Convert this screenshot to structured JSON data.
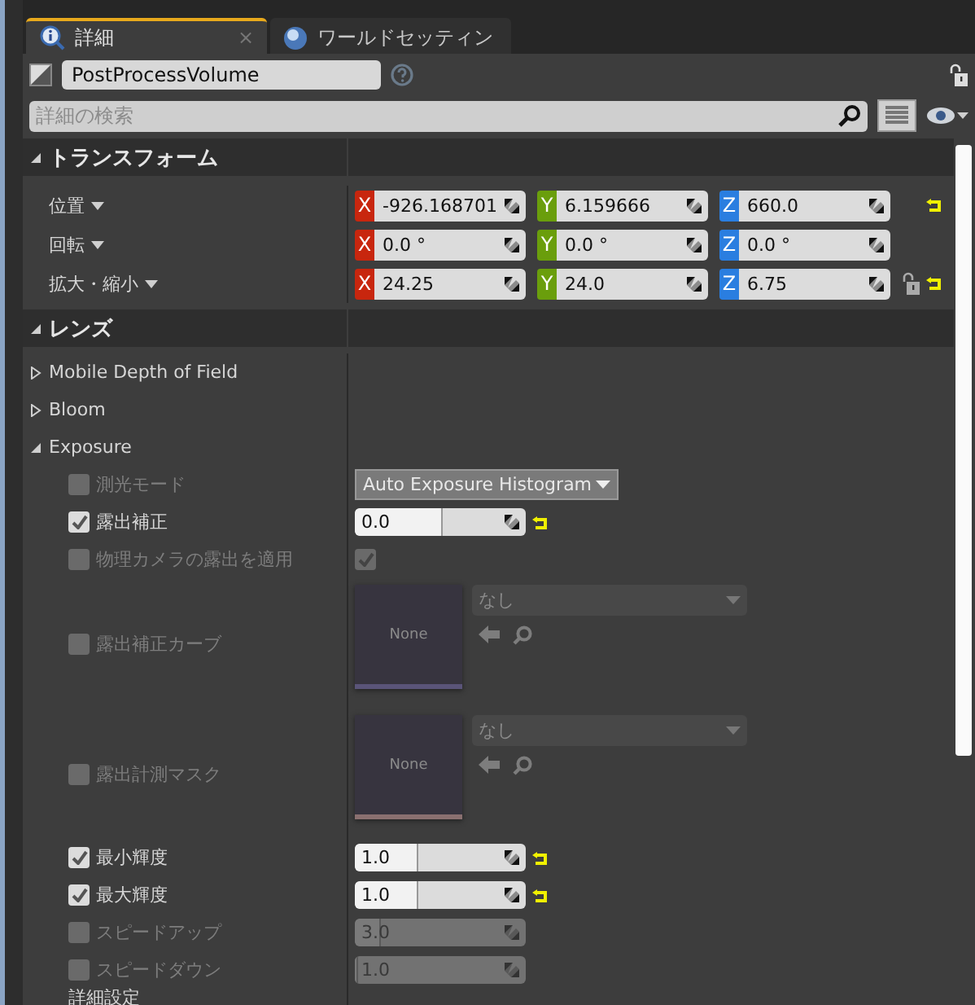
{
  "tabs": [
    {
      "label": "詳細",
      "selected": true,
      "close": "×"
    },
    {
      "label": "ワールドセッティン",
      "selected": false
    }
  ],
  "actor": {
    "name": "PostProcessVolume"
  },
  "search": {
    "placeholder": "詳細の検索"
  },
  "sections": [
    {
      "title": "トランスフォーム",
      "expanded": true,
      "kind": "transform",
      "rows": [
        {
          "label": "位置",
          "reset": true,
          "lock": false,
          "values": [
            {
              "axis": "X",
              "value": "-926.168701"
            },
            {
              "axis": "Y",
              "value": "6.159666"
            },
            {
              "axis": "Z",
              "value": "660.0"
            }
          ]
        },
        {
          "label": "回転",
          "reset": false,
          "lock": false,
          "values": [
            {
              "axis": "X",
              "value": "0.0 °"
            },
            {
              "axis": "Y",
              "value": "0.0 °"
            },
            {
              "axis": "Z",
              "value": "0.0 °"
            }
          ]
        },
        {
          "label": "拡大・縮小",
          "reset": true,
          "lock": true,
          "values": [
            {
              "axis": "X",
              "value": "24.25"
            },
            {
              "axis": "Y",
              "value": "24.0"
            },
            {
              "axis": "Z",
              "value": "6.75"
            }
          ]
        }
      ]
    },
    {
      "title": "レンズ",
      "expanded": true,
      "kind": "props",
      "rows": [
        {
          "kind": "group",
          "label": "Mobile Depth of Field",
          "expanded": false
        },
        {
          "kind": "group",
          "label": "Bloom",
          "expanded": false
        },
        {
          "kind": "group",
          "label": "Exposure",
          "expanded": true,
          "children": [
            {
              "kind": "dropdown",
              "label": "測光モード",
              "checked": false,
              "disabled": true,
              "value": "Auto Exposure Histogram"
            },
            {
              "kind": "number",
              "label": "露出補正",
              "checked": true,
              "disabled": false,
              "value": "0.0",
              "level": 0.5,
              "reset": true
            },
            {
              "kind": "check",
              "label": "物理カメラの露出を適用",
              "checked": false,
              "disabled": true,
              "value_checked": true
            },
            {
              "kind": "asset",
              "label": "露出補正カーブ",
              "checked": false,
              "disabled": true,
              "thumb": "None",
              "color": "#5a5478",
              "value": "なし"
            },
            {
              "kind": "asset",
              "label": "露出計測マスク",
              "checked": false,
              "disabled": true,
              "thumb": "None",
              "color": "#8a7070",
              "value": "なし"
            },
            {
              "kind": "number",
              "label": "最小輝度",
              "checked": true,
              "disabled": false,
              "value": "1.0",
              "level": 0.36,
              "reset": true
            },
            {
              "kind": "number",
              "label": "最大輝度",
              "checked": true,
              "disabled": false,
              "value": "1.0",
              "level": 0.36,
              "reset": true
            },
            {
              "kind": "number",
              "label": "スピードアップ",
              "checked": false,
              "disabled": true,
              "value": "3.0",
              "level": 0.14,
              "reset": false
            },
            {
              "kind": "number",
              "label": "スピードダウン",
              "checked": false,
              "disabled": true,
              "value": "1.0",
              "level": 0.01,
              "reset": false
            },
            {
              "kind": "label",
              "label": "詳細設定"
            }
          ]
        }
      ]
    }
  ]
}
